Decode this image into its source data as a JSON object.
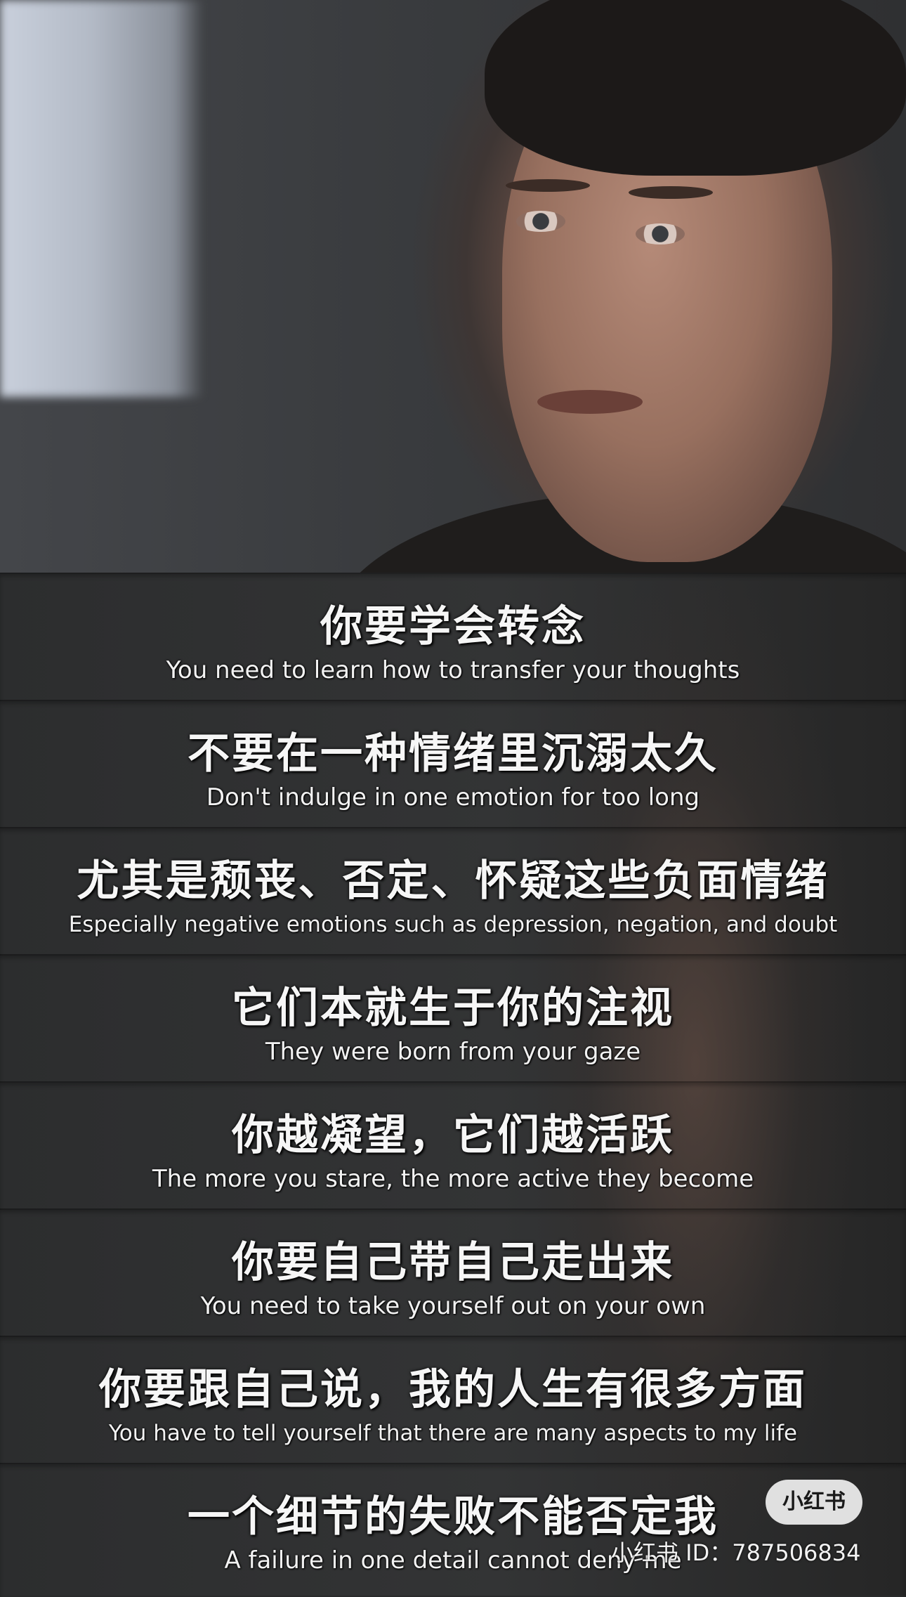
{
  "subtitles": [
    {
      "zh": "你要学会转念",
      "en": "You need to learn how to transfer your thoughts"
    },
    {
      "zh": "不要在一种情绪里沉溺太久",
      "en": "Don't indulge in one emotion for too long"
    },
    {
      "zh": "尤其是颓丧、否定、怀疑这些负面情绪",
      "en": "Especially negative emotions such as depression, negation, and doubt"
    },
    {
      "zh": "它们本就生于你的注视",
      "en": "They were born from your gaze"
    },
    {
      "zh": "你越凝望，它们越活跃",
      "en": "The more you stare, the more active they become"
    },
    {
      "zh": "你要自己带自己走出来",
      "en": "You need to take yourself out on your own"
    },
    {
      "zh": "你要跟自己说，我的人生有很多方面",
      "en": "You have to tell yourself that there are many aspects to my life"
    },
    {
      "zh": "一个细节的失败不能否定我",
      "en": "A failure in one detail cannot deny me"
    }
  ],
  "watermark": {
    "badge": "小红书",
    "id_text": "小红书 ID：787506834"
  }
}
